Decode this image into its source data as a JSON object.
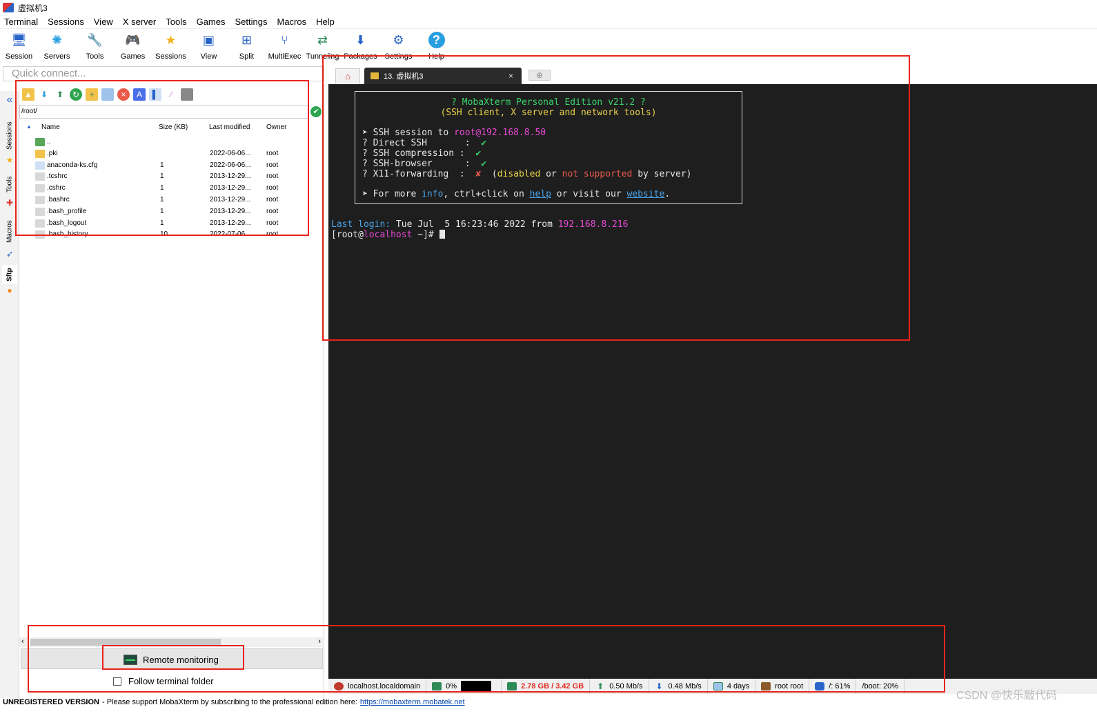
{
  "window": {
    "title": "虚拟机3"
  },
  "menu": [
    "Terminal",
    "Sessions",
    "View",
    "X server",
    "Tools",
    "Games",
    "Settings",
    "Macros",
    "Help"
  ],
  "toolbar": [
    {
      "label": "Session",
      "icon": "session-icon",
      "glyph": "🖥",
      "color": "#2a64c8"
    },
    {
      "label": "Servers",
      "icon": "servers-icon",
      "glyph": "✺",
      "color": "#2a9fe0"
    },
    {
      "label": "Tools",
      "icon": "tools-icon",
      "glyph": "🔧",
      "color": "#d33"
    },
    {
      "label": "Games",
      "icon": "games-icon",
      "glyph": "🎮",
      "color": "#555"
    },
    {
      "label": "Sessions",
      "icon": "star-icon",
      "glyph": "★",
      "color": "#f2b01e"
    },
    {
      "label": "View",
      "icon": "view-icon",
      "glyph": "▣",
      "color": "#2a64c8"
    },
    {
      "label": "Split",
      "icon": "split-icon",
      "glyph": "⊞",
      "color": "#2a64c8"
    },
    {
      "label": "MultiExec",
      "icon": "multiexec-icon",
      "glyph": "⑂",
      "color": "#2a64c8"
    },
    {
      "label": "Tunneling",
      "icon": "tunneling-icon",
      "glyph": "⇄",
      "color": "#2e8b57"
    },
    {
      "label": "Packages",
      "icon": "packages-icon",
      "glyph": "⬇",
      "color": "#2a64c8"
    },
    {
      "label": "Settings",
      "icon": "gear-icon",
      "glyph": "⚙",
      "color": "#2a64c8"
    },
    {
      "label": "Help",
      "icon": "help-icon",
      "glyph": "?",
      "color": "#ffffff"
    }
  ],
  "quick_connect": {
    "placeholder": "Quick connect..."
  },
  "vtabs": [
    "Sessions",
    "Tools",
    "Macros",
    "Sftp"
  ],
  "sftp": {
    "path": "/root/",
    "columns": {
      "name": "Name",
      "size": "Size (KB)",
      "modified": "Last modified",
      "owner": "Owner"
    },
    "rows": [
      {
        "name": "..",
        "size": "",
        "modified": "",
        "owner": "",
        "type": "up"
      },
      {
        "name": ".pki",
        "size": "",
        "modified": "2022-06-06...",
        "owner": "root",
        "type": "folder"
      },
      {
        "name": "anaconda-ks.cfg",
        "size": "1",
        "modified": "2022-06-06...",
        "owner": "root",
        "type": "cfg"
      },
      {
        "name": ".tcshrc",
        "size": "1",
        "modified": "2013-12-29...",
        "owner": "root",
        "type": "file"
      },
      {
        "name": ".cshrc",
        "size": "1",
        "modified": "2013-12-29...",
        "owner": "root",
        "type": "file"
      },
      {
        "name": ".bashrc",
        "size": "1",
        "modified": "2013-12-29...",
        "owner": "root",
        "type": "file"
      },
      {
        "name": ".bash_profile",
        "size": "1",
        "modified": "2013-12-29...",
        "owner": "root",
        "type": "file"
      },
      {
        "name": ".bash_logout",
        "size": "1",
        "modified": "2013-12-29...",
        "owner": "root",
        "type": "file"
      },
      {
        "name": ".bash_history",
        "size": "10",
        "modified": "2022-07-06...",
        "owner": "root",
        "type": "file"
      }
    ],
    "remote_monitoring": "Remote monitoring",
    "follow_folder": "Follow terminal folder"
  },
  "tabs": {
    "session_tab": "13. 虚拟机3",
    "close": "×",
    "new": "⊕"
  },
  "terminal": {
    "banner_title": "? MobaXterm Personal Edition v21.2 ?",
    "banner_subtitle": "(SSH client, X server and network tools)",
    "ssh_prefix": "➤ SSH session to ",
    "ssh_target": "root@192.168.8.50",
    "direct_ssh": "? Direct SSH       :  ",
    "ssh_compression": "? SSH compression :  ",
    "ssh_browser": "? SSH-browser      :  ",
    "x11": "? X11-forwarding  :  ",
    "check": "✔",
    "cross": "✘",
    "x11_disabled": "disabled",
    "x11_or": " or ",
    "x11_not_supported": "not supported",
    "x11_by_server": " by server)",
    "x11_open": "  (",
    "more_prefix": "➤ For more ",
    "more_info": "info",
    "more_mid": ", ctrl+click on ",
    "more_help": "help",
    "more_or": " or visit our ",
    "more_website": "website",
    "more_dot": ".",
    "last_login_label": "Last login:",
    "last_login_date": " Tue Jul  5 16:23:46 2022 from ",
    "last_login_ip": "192.168.8.216",
    "prompt_open": "[root@",
    "prompt_host": "localhost",
    "prompt_close": " ~]# "
  },
  "statusbar": {
    "host": "localhost.localdomain",
    "cpu": "0%",
    "memory": "2.78 GB / 3.42 GB",
    "upload": "0.50 Mb/s",
    "download": "0.48 Mb/s",
    "uptime": "4 days",
    "users": "root  root",
    "disk_root": "/: 61%",
    "disk_boot": "/boot: 20%"
  },
  "footer": {
    "unregistered": "UNREGISTERED VERSION",
    "message": " -  Please support MobaXterm by subscribing to the professional edition here:",
    "link": "https://mobaxterm.mobatek.net"
  },
  "watermark": "CSDN @快乐敲代码",
  "colors": {
    "annotation": "#e8231a",
    "terminal_bg": "#1e1e1e",
    "accent": "#2a64c8"
  }
}
